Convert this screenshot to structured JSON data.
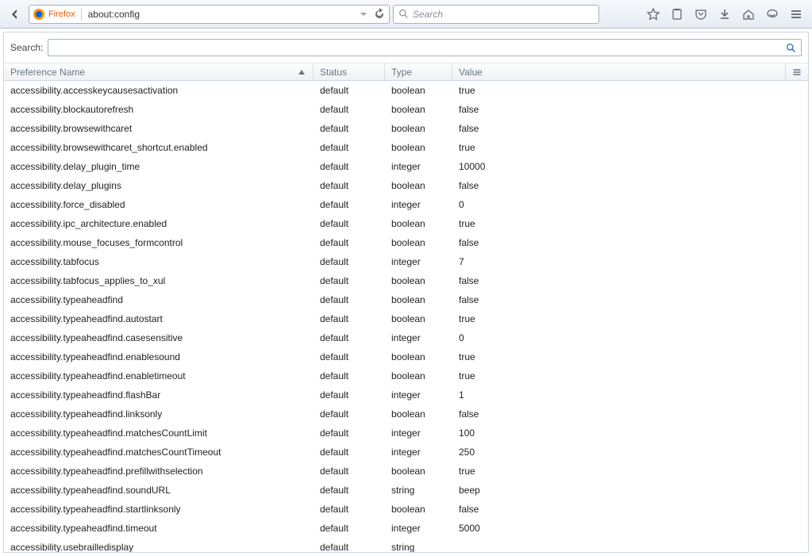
{
  "toolbar": {
    "brand_label": "Firefox",
    "url": "about:config",
    "search_placeholder": "Search"
  },
  "search": {
    "label": "Search:",
    "value": ""
  },
  "columns": {
    "name": "Preference Name",
    "status": "Status",
    "type": "Type",
    "value": "Value"
  },
  "rows": [
    {
      "name": "accessibility.accesskeycausesactivation",
      "status": "default",
      "type": "boolean",
      "value": "true"
    },
    {
      "name": "accessibility.blockautorefresh",
      "status": "default",
      "type": "boolean",
      "value": "false"
    },
    {
      "name": "accessibility.browsewithcaret",
      "status": "default",
      "type": "boolean",
      "value": "false"
    },
    {
      "name": "accessibility.browsewithcaret_shortcut.enabled",
      "status": "default",
      "type": "boolean",
      "value": "true"
    },
    {
      "name": "accessibility.delay_plugin_time",
      "status": "default",
      "type": "integer",
      "value": "10000"
    },
    {
      "name": "accessibility.delay_plugins",
      "status": "default",
      "type": "boolean",
      "value": "false"
    },
    {
      "name": "accessibility.force_disabled",
      "status": "default",
      "type": "integer",
      "value": "0"
    },
    {
      "name": "accessibility.ipc_architecture.enabled",
      "status": "default",
      "type": "boolean",
      "value": "true"
    },
    {
      "name": "accessibility.mouse_focuses_formcontrol",
      "status": "default",
      "type": "boolean",
      "value": "false"
    },
    {
      "name": "accessibility.tabfocus",
      "status": "default",
      "type": "integer",
      "value": "7"
    },
    {
      "name": "accessibility.tabfocus_applies_to_xul",
      "status": "default",
      "type": "boolean",
      "value": "false"
    },
    {
      "name": "accessibility.typeaheadfind",
      "status": "default",
      "type": "boolean",
      "value": "false"
    },
    {
      "name": "accessibility.typeaheadfind.autostart",
      "status": "default",
      "type": "boolean",
      "value": "true"
    },
    {
      "name": "accessibility.typeaheadfind.casesensitive",
      "status": "default",
      "type": "integer",
      "value": "0"
    },
    {
      "name": "accessibility.typeaheadfind.enablesound",
      "status": "default",
      "type": "boolean",
      "value": "true"
    },
    {
      "name": "accessibility.typeaheadfind.enabletimeout",
      "status": "default",
      "type": "boolean",
      "value": "true"
    },
    {
      "name": "accessibility.typeaheadfind.flashBar",
      "status": "default",
      "type": "integer",
      "value": "1"
    },
    {
      "name": "accessibility.typeaheadfind.linksonly",
      "status": "default",
      "type": "boolean",
      "value": "false"
    },
    {
      "name": "accessibility.typeaheadfind.matchesCountLimit",
      "status": "default",
      "type": "integer",
      "value": "100"
    },
    {
      "name": "accessibility.typeaheadfind.matchesCountTimeout",
      "status": "default",
      "type": "integer",
      "value": "250"
    },
    {
      "name": "accessibility.typeaheadfind.prefillwithselection",
      "status": "default",
      "type": "boolean",
      "value": "true"
    },
    {
      "name": "accessibility.typeaheadfind.soundURL",
      "status": "default",
      "type": "string",
      "value": "beep"
    },
    {
      "name": "accessibility.typeaheadfind.startlinksonly",
      "status": "default",
      "type": "boolean",
      "value": "false"
    },
    {
      "name": "accessibility.typeaheadfind.timeout",
      "status": "default",
      "type": "integer",
      "value": "5000"
    },
    {
      "name": "accessibility.usebrailledisplay",
      "status": "default",
      "type": "string",
      "value": ""
    }
  ]
}
